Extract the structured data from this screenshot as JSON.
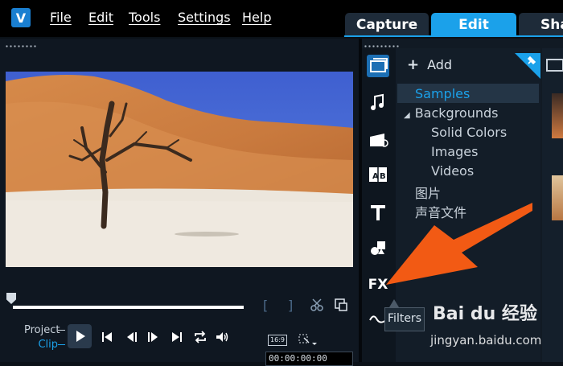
{
  "app": {
    "logo_glyph": "V"
  },
  "menu": [
    "File",
    "Edit",
    "Tools",
    "Settings",
    "Help"
  ],
  "tabs": [
    "Capture",
    "Edit",
    "Sha"
  ],
  "active_tab": "Edit",
  "player": {
    "project_label": "Project",
    "clip_label": "Clip",
    "aspect_ratio": "16:9",
    "timecode": "00:00:00:00",
    "progress_fraction": 0.0
  },
  "library": {
    "add_label": "Add",
    "tree": {
      "samples": "Samples",
      "backgrounds": "Backgrounds",
      "solid_colors": "Solid Colors",
      "images": "Images",
      "videos": "Videos",
      "folder_1": "图片",
      "folder_2": "声音文件"
    },
    "fx_label": "FX",
    "tooltip": "Filters"
  },
  "watermark": {
    "logo": "Bai du 经验",
    "url": "jingyan.baidu.com"
  },
  "colors": {
    "accent": "#1ba1ea",
    "arrow": "#f25a14",
    "panel": "#111a24",
    "menubar": "#000000"
  }
}
